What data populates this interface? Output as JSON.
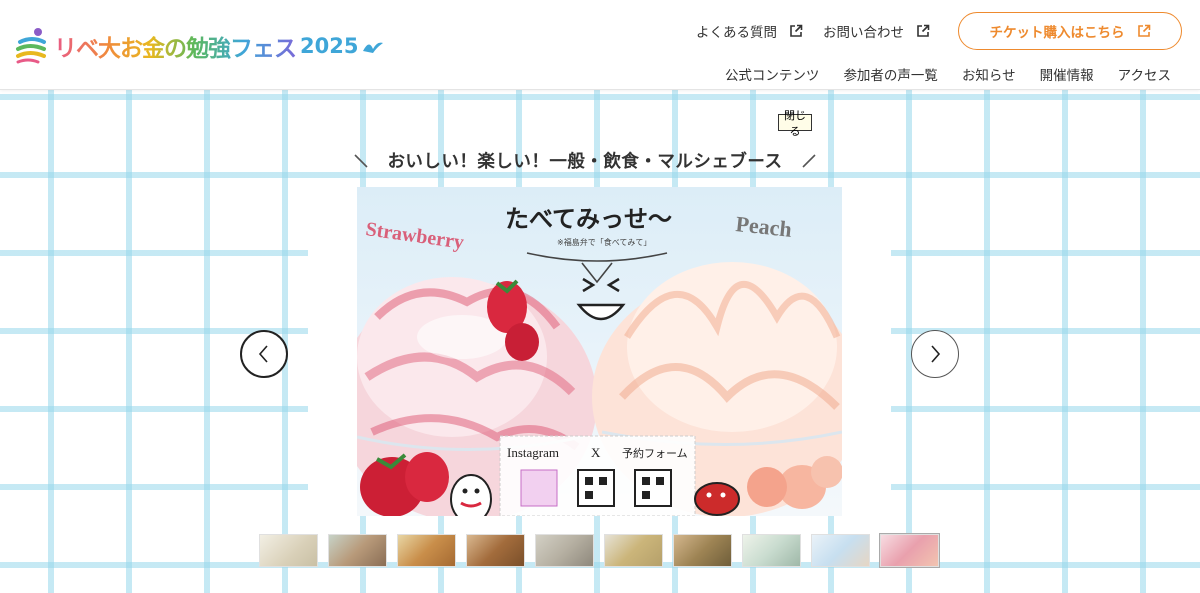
{
  "header": {
    "logo": {
      "text": "リベ大お金の勉強フェス",
      "year": "2025"
    },
    "top_links": [
      {
        "label": "よくある質問",
        "icon": "external-link-icon"
      },
      {
        "label": "お問い合わせ",
        "icon": "external-link-icon"
      }
    ],
    "ticket_button": {
      "label": "チケット購入はこちら",
      "icon": "external-link-icon"
    },
    "nav": [
      "公式コンテンツ",
      "参加者の声一覧",
      "お知らせ",
      "開催情報",
      "アクセス"
    ]
  },
  "popup": {
    "close_label": "閉じる",
    "title": "おいしい！楽しい！一般・飲食・マルシェブース"
  },
  "slide": {
    "left_word": "Strawberry",
    "right_word": "Peach",
    "headline": "たべてみっせ～",
    "note": "※福島弁で「食べてみて」",
    "sns_labels": [
      "Instagram",
      "X",
      "予約フォーム"
    ]
  },
  "slider": {
    "thumbnail_count": 10,
    "active_index": 9
  },
  "colors": {
    "accent": "#ee8a2e",
    "grid": "#96d7eb",
    "text": "#333333"
  }
}
